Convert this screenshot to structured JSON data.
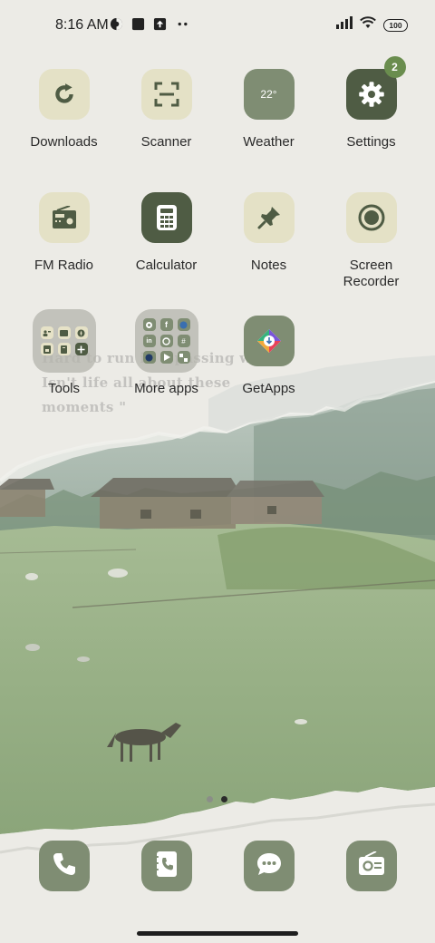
{
  "status_bar": {
    "time": "8:16 AM",
    "battery": "100",
    "left_icons": [
      "vpn-icon",
      "stop-icon",
      "upload-icon",
      "more-dots-icon"
    ],
    "right_icons": [
      "signal-icon",
      "wifi-icon",
      "battery-icon"
    ]
  },
  "wallpaper": {
    "quote_lines": [
      "Hard to run in a passing world",
      "Isn't life all about these",
      "moments \""
    ]
  },
  "apps": [
    {
      "label": "Downloads",
      "icon": "refresh-icon"
    },
    {
      "label": "Scanner",
      "icon": "scan-frame-icon"
    },
    {
      "label": "Weather",
      "icon": "weather-icon",
      "temp": "22°"
    },
    {
      "label": "Settings",
      "icon": "gear-icon",
      "badge": "2"
    },
    {
      "label": "FM Radio",
      "icon": "radio-icon"
    },
    {
      "label": "Calculator",
      "icon": "calculator-icon"
    },
    {
      "label": "Notes",
      "icon": "pin-icon"
    },
    {
      "label": "Screen\nRecorder",
      "label_line1": "Screen",
      "label_line2": "Recorder",
      "icon": "record-icon"
    },
    {
      "label": "Tools",
      "icon": "folder-icon"
    },
    {
      "label": "More apps",
      "icon": "folder-icon"
    },
    {
      "label": "GetApps",
      "icon": "getapps-icon"
    }
  ],
  "pager": {
    "pages": 2,
    "active": 2
  },
  "dock": [
    {
      "icon": "phone-icon"
    },
    {
      "icon": "contacts-icon"
    },
    {
      "icon": "messages-icon"
    },
    {
      "icon": "id-card-icon"
    }
  ],
  "colors": {
    "light_tile": "#e4e1c6",
    "mid_tile": "#7f8d73",
    "dark_tile": "#4f5c44",
    "badge": "#6a8d4e"
  }
}
